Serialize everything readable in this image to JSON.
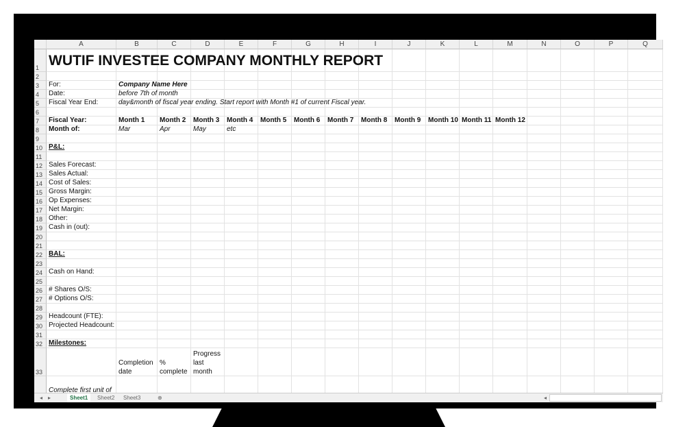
{
  "columns": [
    "A",
    "B",
    "C",
    "D",
    "E",
    "F",
    "G",
    "H",
    "I",
    "J",
    "K",
    "L",
    "M",
    "N",
    "O",
    "P",
    "Q"
  ],
  "rows": [
    {
      "n": "1",
      "cells": [
        {
          "col": "A",
          "text": "WUTIF INVESTEE COMPANY MONTHLY REPORT",
          "style": "title"
        }
      ]
    },
    {
      "n": "2",
      "cells": []
    },
    {
      "n": "3",
      "cells": [
        {
          "col": "A",
          "text": "For:"
        },
        {
          "col": "B",
          "text": "Company Name Here",
          "style": "b i"
        }
      ]
    },
    {
      "n": "4",
      "cells": [
        {
          "col": "A",
          "text": "Date:"
        },
        {
          "col": "B",
          "text": "before 7th of month",
          "style": "i"
        }
      ]
    },
    {
      "n": "5",
      "cells": [
        {
          "col": "A",
          "text": "Fiscal Year End:"
        },
        {
          "col": "B",
          "text": "day&month of fiscal year ending. Start report with Month #1 of current Fiscal year.",
          "style": "i"
        }
      ]
    },
    {
      "n": "6",
      "cells": []
    },
    {
      "n": "7",
      "cells": [
        {
          "col": "A",
          "text": "Fiscal Year:",
          "style": "b"
        },
        {
          "col": "B",
          "text": "Month 1",
          "style": "b"
        },
        {
          "col": "C",
          "text": "Month 2",
          "style": "b"
        },
        {
          "col": "D",
          "text": "Month 3",
          "style": "b"
        },
        {
          "col": "E",
          "text": "Month 4",
          "style": "b"
        },
        {
          "col": "F",
          "text": "Month 5",
          "style": "b"
        },
        {
          "col": "G",
          "text": "Month 6",
          "style": "b"
        },
        {
          "col": "H",
          "text": "Month 7",
          "style": "b"
        },
        {
          "col": "I",
          "text": "Month 8",
          "style": "b"
        },
        {
          "col": "J",
          "text": "Month 9",
          "style": "b"
        },
        {
          "col": "K",
          "text": "Month 10",
          "style": "b"
        },
        {
          "col": "L",
          "text": "Month 11",
          "style": "b"
        },
        {
          "col": "M",
          "text": "Month 12",
          "style": "b"
        }
      ]
    },
    {
      "n": "8",
      "cells": [
        {
          "col": "A",
          "text": "Month of:",
          "style": "b"
        },
        {
          "col": "B",
          "text": "Mar",
          "style": "i"
        },
        {
          "col": "C",
          "text": "Apr",
          "style": "i"
        },
        {
          "col": "D",
          "text": "May",
          "style": "i"
        },
        {
          "col": "E",
          "text": "etc",
          "style": "i"
        }
      ]
    },
    {
      "n": "9",
      "cells": []
    },
    {
      "n": "10",
      "cells": [
        {
          "col": "A",
          "text": "P&L:",
          "style": "b u"
        }
      ]
    },
    {
      "n": "11",
      "cells": []
    },
    {
      "n": "12",
      "cells": [
        {
          "col": "A",
          "text": "Sales Forecast:"
        }
      ]
    },
    {
      "n": "13",
      "cells": [
        {
          "col": "A",
          "text": "Sales Actual:"
        }
      ]
    },
    {
      "n": "14",
      "cells": [
        {
          "col": "A",
          "text": "Cost of Sales:"
        }
      ]
    },
    {
      "n": "15",
      "cells": [
        {
          "col": "A",
          "text": "Gross Margin:"
        }
      ]
    },
    {
      "n": "16",
      "cells": [
        {
          "col": "A",
          "text": "Op Expenses:"
        }
      ]
    },
    {
      "n": "17",
      "cells": [
        {
          "col": "A",
          "text": "Net Margin:"
        }
      ]
    },
    {
      "n": "18",
      "cells": [
        {
          "col": "A",
          "text": "Other:"
        }
      ]
    },
    {
      "n": "19",
      "cells": [
        {
          "col": "A",
          "text": "Cash in (out):"
        }
      ]
    },
    {
      "n": "20",
      "cells": []
    },
    {
      "n": "21",
      "cells": []
    },
    {
      "n": "22",
      "cells": [
        {
          "col": "A",
          "text": "BAL:",
          "style": "b u"
        }
      ]
    },
    {
      "n": "23",
      "cells": []
    },
    {
      "n": "24",
      "cells": [
        {
          "col": "A",
          "text": "Cash on Hand:"
        }
      ]
    },
    {
      "n": "25",
      "cells": []
    },
    {
      "n": "26",
      "cells": [
        {
          "col": "A",
          "text": "# Shares O/S:"
        }
      ]
    },
    {
      "n": "27",
      "cells": [
        {
          "col": "A",
          "text": "# Options O/S:"
        }
      ]
    },
    {
      "n": "28",
      "cells": []
    },
    {
      "n": "29",
      "cells": [
        {
          "col": "A",
          "text": "Headcount (FTE):"
        }
      ]
    },
    {
      "n": "30",
      "cells": [
        {
          "col": "A",
          "text": "Projected Headcount:"
        }
      ]
    },
    {
      "n": "31",
      "cells": []
    },
    {
      "n": "32",
      "cells": [
        {
          "col": "A",
          "text": "Milestones:",
          "style": "b u"
        }
      ]
    },
    {
      "n": "33",
      "cells": [
        {
          "col": "B",
          "text": "Completion date",
          "style": "wrap"
        },
        {
          "col": "C",
          "text": "% complete",
          "style": "wrap"
        },
        {
          "col": "D",
          "text": "Progress last month",
          "style": "wrap"
        }
      ]
    },
    {
      "n": "",
      "cells": [
        {
          "col": "A",
          "text": "Complete first unit of fully demonstrable",
          "style": "i wrap"
        }
      ]
    }
  ],
  "sheets": [
    "Sheet1",
    "Sheet2",
    "Sheet3"
  ],
  "active_sheet": "Sheet1",
  "add_sheet_icon": "plus-circle-icon"
}
